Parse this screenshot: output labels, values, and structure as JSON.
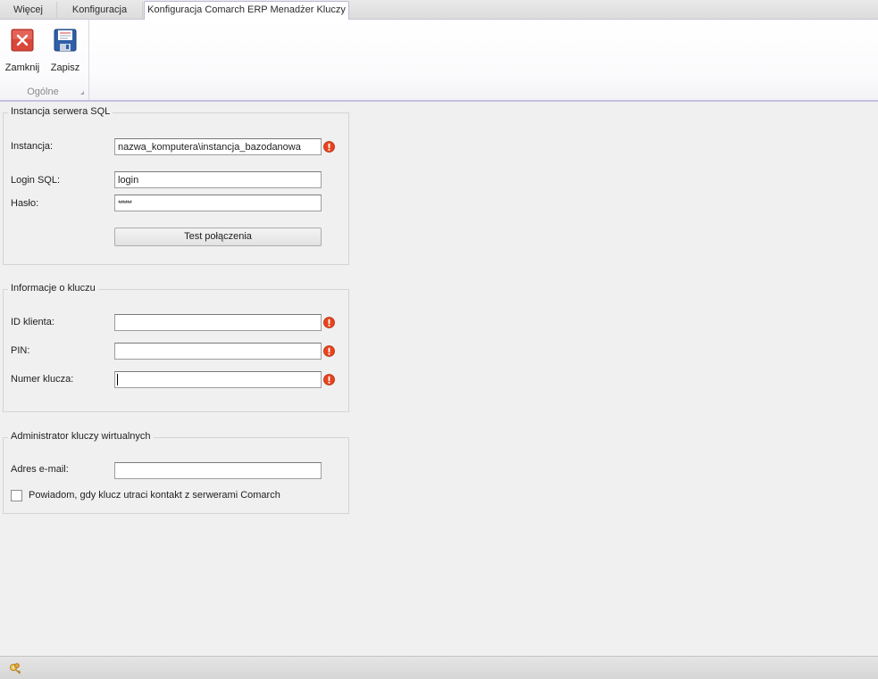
{
  "tabs": [
    {
      "label": "Więcej"
    },
    {
      "label": "Konfiguracja"
    },
    {
      "label": "Konfiguracja Comarch ERP Menadżer Kluczy"
    }
  ],
  "ribbon": {
    "group_label": "Ogólne",
    "close_label": "Zamknij",
    "save_label": "Zapisz"
  },
  "sql": {
    "title": "Instancja serwera SQL",
    "instance_label": "Instancja:",
    "instance_value": "nazwa_komputera\\instancja_bazodanowa",
    "login_label": "Login SQL:",
    "login_value": "login",
    "password_label": "Hasło:",
    "password_value": "******",
    "test_button": "Test połączenia"
  },
  "key": {
    "title": "Informacje o kluczu",
    "client_id_label": "ID klienta:",
    "client_id_value": "",
    "pin_label": "PIN:",
    "pin_value": "",
    "key_number_label": "Numer klucza:",
    "key_number_value": ""
  },
  "admin": {
    "title": "Administrator kluczy wirtualnych",
    "email_label": "Adres e-mail:",
    "email_value": "",
    "notify_label": "Powiadom, gdy klucz utraci kontakt z serwerami Comarch",
    "notify_checked": false
  },
  "colors": {
    "error_icon": "#e8431d",
    "close_icon": "#d9463a",
    "save_icon": "#2f5fa8",
    "ribbon_border": "#c7bfe0"
  },
  "icons": {
    "close": "close-icon",
    "save": "floppy-disk-icon",
    "error": "error-exclamation-icon",
    "status": "keys-icon"
  }
}
